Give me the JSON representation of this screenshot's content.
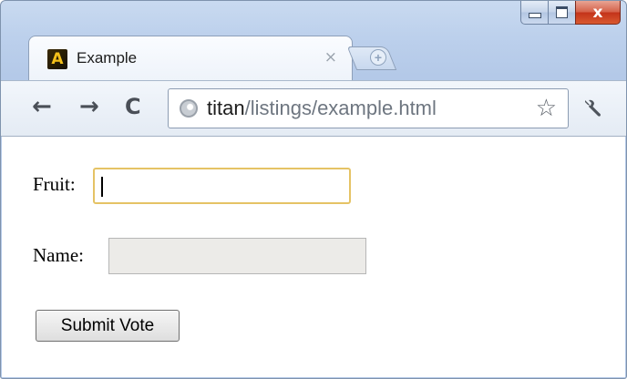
{
  "window": {
    "close_glyph": "x"
  },
  "tab": {
    "favicon_letter": "A",
    "title": "Example",
    "close_glyph": "×",
    "new_tab_glyph": "+"
  },
  "toolbar": {
    "back_glyph": "←",
    "forward_glyph": "→",
    "reload_glyph": "C",
    "bookmark_glyph": "☆",
    "url_host": "titan",
    "url_path": "/listings/example.html"
  },
  "icons": {
    "back": "back-arrow-icon",
    "forward": "forward-arrow-icon",
    "reload": "reload-icon",
    "site": "globe-icon",
    "bookmark": "star-icon",
    "settings": "wrench-icon"
  },
  "form": {
    "fruit_label": "Fruit:",
    "fruit_value": "",
    "name_label": "Name:",
    "name_value": "",
    "submit_label": "Submit Vote"
  },
  "colors": {
    "focus_border": "#e5c365",
    "disabled_bg": "#ecebe8",
    "close_button": "#c3331a"
  }
}
